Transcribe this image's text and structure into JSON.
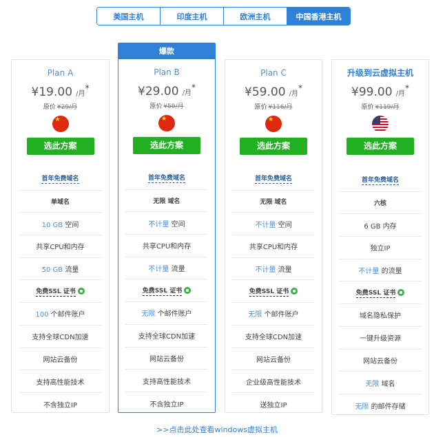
{
  "tabs": [
    {
      "label": "美国主机"
    },
    {
      "label": "印度主机"
    },
    {
      "label": "欧洲主机"
    },
    {
      "label": "中国香港主机"
    }
  ],
  "hot_badge": "爆款",
  "select_label": "选此方案",
  "plans": [
    {
      "name": "Plan A",
      "currency": "¥",
      "price": "19.00",
      "per": "/月",
      "star": "*",
      "orig_label": "原价",
      "orig_price": "¥29/月",
      "flag": "china-flag-icon",
      "features": [
        "首年免费域名",
        "单域名",
        "10 GB 空间",
        "共享CPU和内存",
        "50 GB 流量",
        "免费SSL 证书",
        "100 个邮件账户",
        "支持全球CDN加速",
        "网站云备份",
        "支持高性能技术",
        "不含独立IP"
      ]
    },
    {
      "name": "Plan B",
      "currency": "¥",
      "price": "29.00",
      "per": "/月",
      "star": "*",
      "orig_label": "原价",
      "orig_price": "¥59/月",
      "flag": "china-flag-icon",
      "features": [
        "首年免费域名",
        "无限 域名",
        "不计量 空间",
        "共享CPU和内存",
        "不计量 流量",
        "免费SSL 证书",
        "无限 个邮件账户",
        "支持全球CDN加速",
        "网站云备份",
        "支持高性能技术",
        "不含独立IP"
      ]
    },
    {
      "name": "Plan C",
      "currency": "¥",
      "price": "59.00",
      "per": "/月",
      "star": "*",
      "orig_label": "原价",
      "orig_price": "¥116/月",
      "flag": "china-flag-icon",
      "features": [
        "首年免费域名",
        "无限 域名",
        "不计量 空间",
        "共享CPU和内存",
        "不计量 流量",
        "免费SSL 证书",
        "无限 个邮件账户",
        "支持全球CDN加速",
        "网站云备份",
        "企业级高性能技术",
        "送独立IP"
      ]
    },
    {
      "name": "升级到云虚拟主机",
      "currency": "¥",
      "price": "99.00",
      "per": "/月",
      "star": "*",
      "orig_label": "原价",
      "orig_price": "¥119/月",
      "flag": "us-flag-icon",
      "features": [
        "首年免费域名",
        "六核",
        "6 GB 内存",
        "独立IP",
        "不计量 的流量",
        "免费SSL 证书",
        "域名隐私保护",
        "一键升级资源",
        "网站云备份",
        "无限 域名",
        "无限 的邮件存储"
      ]
    }
  ],
  "bottom_link": ">>点击此处查看windows虚拟主机"
}
